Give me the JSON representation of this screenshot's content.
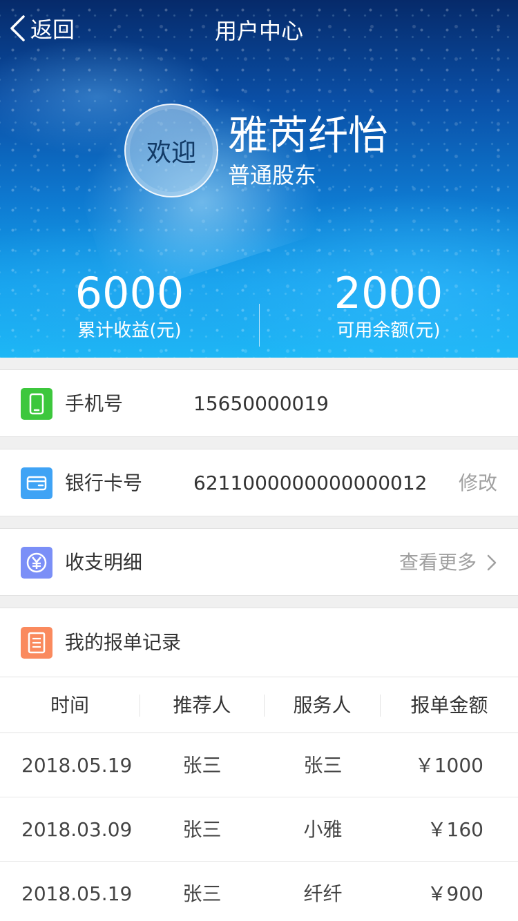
{
  "header": {
    "back_label": "返回",
    "title": "用户中心"
  },
  "profile": {
    "avatar_text": "欢迎",
    "name": "雅芮纤怡",
    "role": "普通股东"
  },
  "stats": {
    "total_income": {
      "value": "6000",
      "label": "累计收益(元)"
    },
    "available_balance": {
      "value": "2000",
      "label": "可用余额(元)"
    }
  },
  "rows": {
    "phone": {
      "label": "手机号",
      "value": "15650000019",
      "icon": "phone-icon",
      "color": "#3dc73d"
    },
    "bank": {
      "label": "银行卡号",
      "value": "6211000000000000012",
      "action": "修改",
      "icon": "card-icon",
      "color": "#3fa3f5"
    },
    "detail": {
      "label": "收支明细",
      "action": "查看更多",
      "icon": "yuan-icon",
      "color": "#7b8ff7"
    }
  },
  "records": {
    "title": "我的报单记录",
    "icon": "document-icon",
    "color": "#fa8a5e",
    "columns": [
      "时间",
      "推荐人",
      "服务人",
      "报单金额"
    ],
    "items": [
      {
        "date": "2018.05.19",
        "referrer": "张三",
        "server": "张三",
        "amount": "￥1000"
      },
      {
        "date": "2018.03.09",
        "referrer": "张三",
        "server": "小雅",
        "amount": "￥160"
      },
      {
        "date": "2018.05.19",
        "referrer": "张三",
        "server": "纤纤",
        "amount": "￥900"
      }
    ]
  }
}
